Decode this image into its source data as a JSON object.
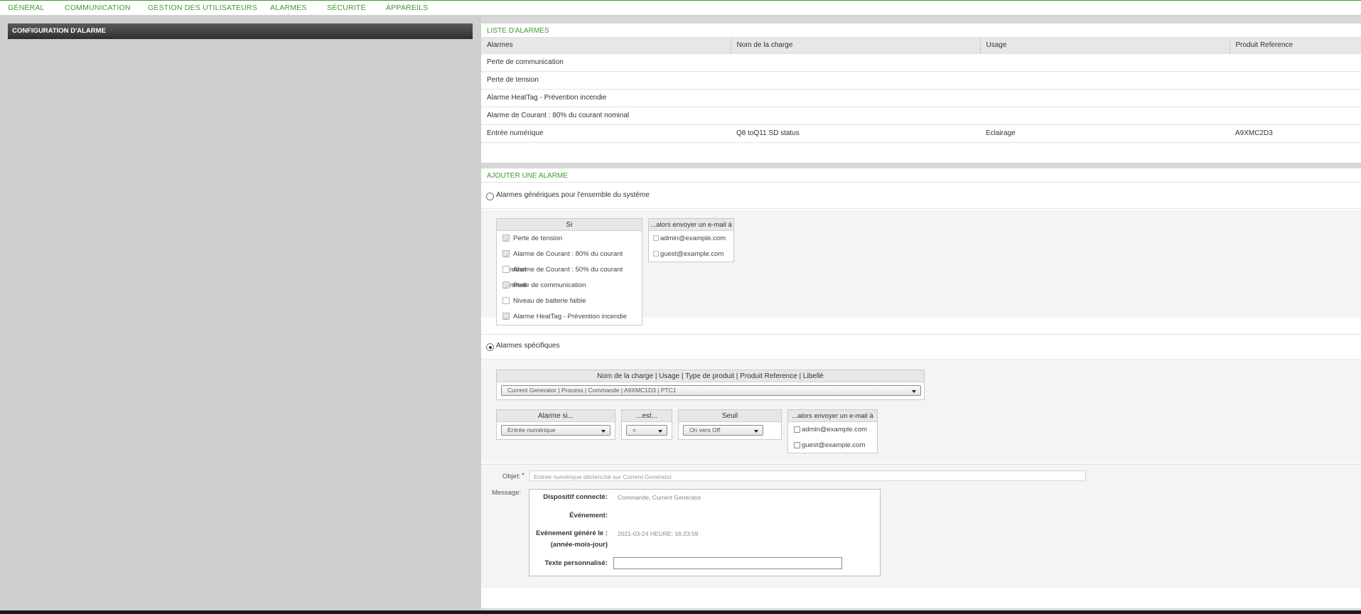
{
  "nav": {
    "tabs": [
      {
        "label": "GÉNÉRAL"
      },
      {
        "label": "COMMUNICATION"
      },
      {
        "label": "GESTION DES UTILISATEURS"
      },
      {
        "label": "ALARMES"
      },
      {
        "label": "SÉCURITÉ"
      },
      {
        "label": "APPAREILS"
      }
    ],
    "active": "ALARMES"
  },
  "left": {
    "header": "CONFIGURATION D'ALARME"
  },
  "alarm_list": {
    "title": "LISTE D'ALARMES",
    "columns": [
      "Alarmes",
      "Nom de la charge",
      "Usage",
      "Produit Reference"
    ],
    "rows": [
      [
        "Perte de communication",
        "",
        "",
        ""
      ],
      [
        "Perte de tension",
        "",
        "",
        ""
      ],
      [
        "Alarme HeatTag - Prévention incendie",
        "",
        "",
        ""
      ],
      [
        "Alarme de Courant : 80% du courant nominal",
        "",
        "",
        ""
      ],
      [
        "Entrée numérique",
        "Q8 toQ11 SD status",
        "Eclairage",
        "A9XMC2D3"
      ]
    ]
  },
  "add_alarm": {
    "title": "AJOUTER UNE ALARME",
    "generic_label": "Alarmes génériques pour l'ensemble du système",
    "si_box": {
      "header": "Si",
      "items": [
        {
          "label": "Perte de tension",
          "state": "checked-disabled"
        },
        {
          "label": "Alarme de Courant : 80% du courant nominal",
          "state": "checked-disabled"
        },
        {
          "label": "Alarme de Courant : 50% du courant nominal",
          "state": "disabled"
        },
        {
          "label": "Perte de communication",
          "state": "checked-disabled"
        },
        {
          "label": "Niveau de batterie faible",
          "state": "disabled"
        },
        {
          "label": "Alarme HeatTag - Prévention incendie",
          "state": "checked-disabled"
        }
      ]
    },
    "email_box_generic": {
      "header": "...alors envoyer un e-mail à",
      "items": [
        "admin@example.com",
        "guest@example.com"
      ]
    },
    "specific_label": "Alarmes spécifiques",
    "load_selector": {
      "header": "Nom de la charge | Usage | Type de produit | Produit Reference | Libellé",
      "value": "Current Generator | Process | Commande | A9XMC1D3 | PTC1"
    },
    "alarm_if": {
      "header": "Alarme si...",
      "value": "Entrée numérique"
    },
    "is": {
      "header": "...est...",
      "value": "="
    },
    "threshold": {
      "header": "Seuil",
      "value": "On vers Off"
    },
    "email_box_specific": {
      "header": "...alors envoyer un e-mail à",
      "items": [
        "admin@example.com",
        "guest@example.com"
      ]
    },
    "object_label": "Objet:",
    "required_mark": "*",
    "object_value": "Entrée numérique    déclenché sur Current Generator",
    "message_label": "Message:",
    "message": {
      "device_label": "Dispositif connecté:",
      "device_value": "Commande, Current Generator",
      "event_label": "Événement:",
      "event_value": "",
      "generated_label_1": "Evénement généré le :",
      "generated_label_2": "(année-mois-jour)",
      "generated_value": "2021-03-24 HEURE: 16:23:59",
      "custom_label": "Texte personnalisé:",
      "custom_value": ""
    }
  },
  "colors": {
    "accent": "#3d9a2f",
    "header_dark": "#2f2f2f",
    "panel_gray": "#cfcfcf"
  }
}
